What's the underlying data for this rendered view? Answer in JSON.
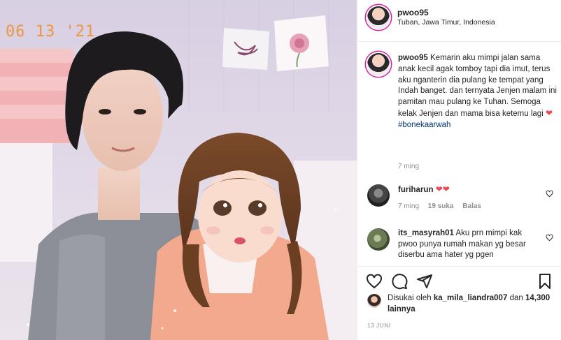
{
  "photo": {
    "date_stamp": "06 13 '21",
    "alt": ""
  },
  "header": {
    "username": "pwoo95",
    "location": "Tuban, Jawa Timur, Indonesia"
  },
  "caption": {
    "username": "pwoo95",
    "text": "Kemarin aku mimpi jalan sama anak kecil agak tomboy tapi dia imut, terus aku nganterin dia pulang ke tempat yang Indah banget. dan ternyata Jenjen malam ini pamitan mau pulang ke Tuhan. Semoga kelak Jenjen dan mama bisa ketemu lagi",
    "emoji": "❤",
    "hashtag": "#bonekaarwah",
    "time": "7 ming"
  },
  "comments": [
    {
      "username": "furiharun",
      "text": "❤❤",
      "time": "7 ming",
      "likes": "19 suka",
      "reply_label": "Balas"
    },
    {
      "username": "its_masyrah01",
      "text": "Aku prn mimpi kak pwoo punya rumah makan yg besar diserbu ama hater yg pgen",
      "time": "",
      "likes": "",
      "reply_label": ""
    }
  ],
  "likes": {
    "prefix": "Disukai oleh",
    "user": "ka_mila_liandra007",
    "middle": "dan",
    "count": "14,300 lainnya"
  },
  "date": "13 JUNI",
  "colors": {
    "accent_heart": "#ed4956",
    "link": "#00376b",
    "muted": "#8e8e8e",
    "stamp": "#e39a57"
  },
  "icons": [
    "heart-icon",
    "comment-icon",
    "share-icon",
    "bookmark-icon"
  ]
}
